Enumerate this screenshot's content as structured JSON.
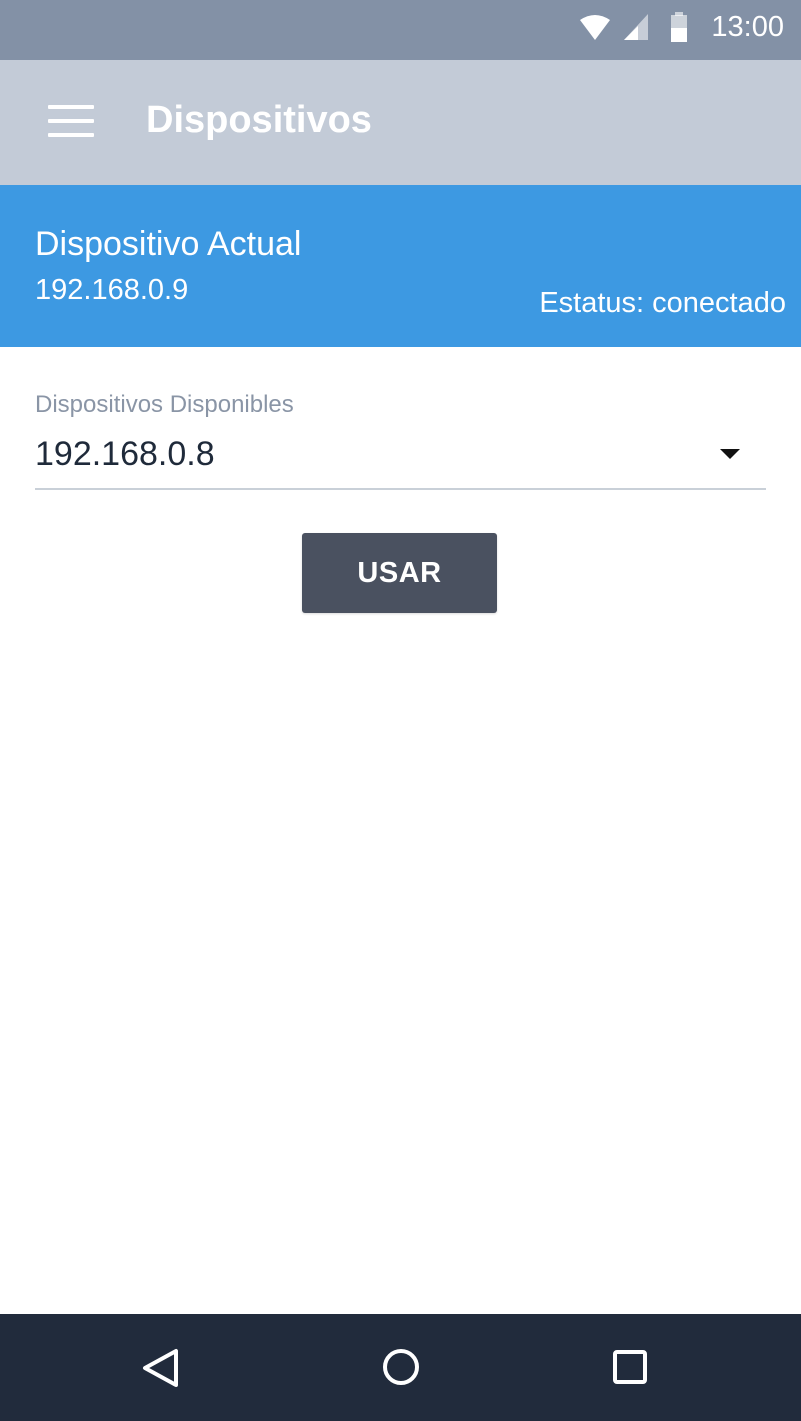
{
  "status_bar": {
    "time": "13:00",
    "icons": [
      "wifi-icon",
      "signal-icon",
      "battery-icon"
    ]
  },
  "app_bar": {
    "title": "Dispositivos",
    "menu_icon": "menu-icon"
  },
  "current_device": {
    "title": "Dispositivo Actual",
    "ip": "192.168.0.9",
    "status": "Estatus: conectado"
  },
  "available_devices": {
    "label": "Dispositivos Disponibles",
    "selected": "192.168.0.8"
  },
  "use_button": {
    "label": "USAR"
  },
  "nav_bar": {
    "icons": [
      "back-icon",
      "home-icon",
      "recents-icon"
    ]
  },
  "colors": {
    "status_bar": "#8391a6",
    "app_bar": "#c3cbd7",
    "accent": "#3d99e2",
    "button": "#4a5160",
    "nav_bar": "#212b3c"
  }
}
